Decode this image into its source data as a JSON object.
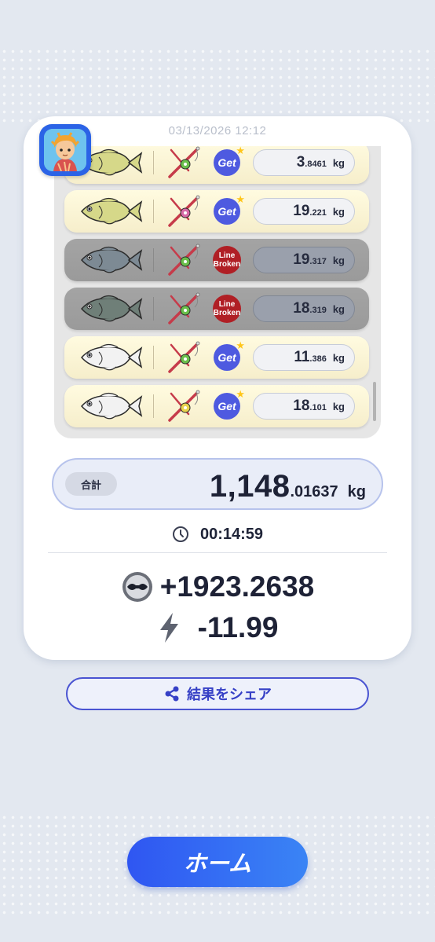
{
  "result": {
    "timestamp": "03/13/2026 12:12",
    "catches": [
      {
        "status": "get",
        "badge": "Get",
        "weight_int": "3",
        "weight_dec": ".8461",
        "unit": "kg",
        "fish_color": "#d6d889",
        "fish_icon": "bass-fish-icon",
        "rod_icon": "green-fishing-rod-icon"
      },
      {
        "status": "get",
        "badge": "Get",
        "weight_int": "19",
        "weight_dec": ".221",
        "unit": "kg",
        "fish_color": "#d6d889",
        "fish_icon": "bass-fish-icon",
        "rod_icon": "pink-fishing-rod-icon"
      },
      {
        "status": "broken",
        "badge_line1": "Line",
        "badge_line2": "Broken",
        "weight_int": "19",
        "weight_dec": ".317",
        "unit": "kg",
        "fish_color": "#7d8a94",
        "fish_icon": "yellowtail-fish-icon",
        "rod_icon": "green-fishing-rod-icon"
      },
      {
        "status": "broken",
        "badge_line1": "Line",
        "badge_line2": "Broken",
        "weight_int": "18",
        "weight_dec": ".319",
        "unit": "kg",
        "fish_color": "#6f7f78",
        "fish_icon": "salmon-fish-icon",
        "rod_icon": "green-fishing-rod-icon"
      },
      {
        "status": "get",
        "badge": "Get",
        "weight_int": "11",
        "weight_dec": ".386",
        "unit": "kg",
        "fish_color": "#f2f2f2",
        "fish_icon": "grouper-fish-icon",
        "rod_icon": "green-fishing-rod-icon"
      },
      {
        "status": "get",
        "badge": "Get",
        "weight_int": "18",
        "weight_dec": ".101",
        "unit": "kg",
        "fish_color": "#f2f2f2",
        "fish_icon": "grouper-fish-icon",
        "rod_icon": "yellow-fishing-rod-icon"
      }
    ],
    "total": {
      "label": "合計",
      "int": "1,148",
      "dec": ".01637",
      "unit": "kg"
    },
    "elapsed_time": "00:14:59",
    "coins": "+1923.2638",
    "energy": "-11.99"
  },
  "actions": {
    "share_label": "結果をシェア",
    "home_label": "ホーム"
  },
  "colors": {
    "accent": "#2f56f2",
    "get_badge": "#4e5ae0",
    "broken_badge": "#b01f25"
  }
}
